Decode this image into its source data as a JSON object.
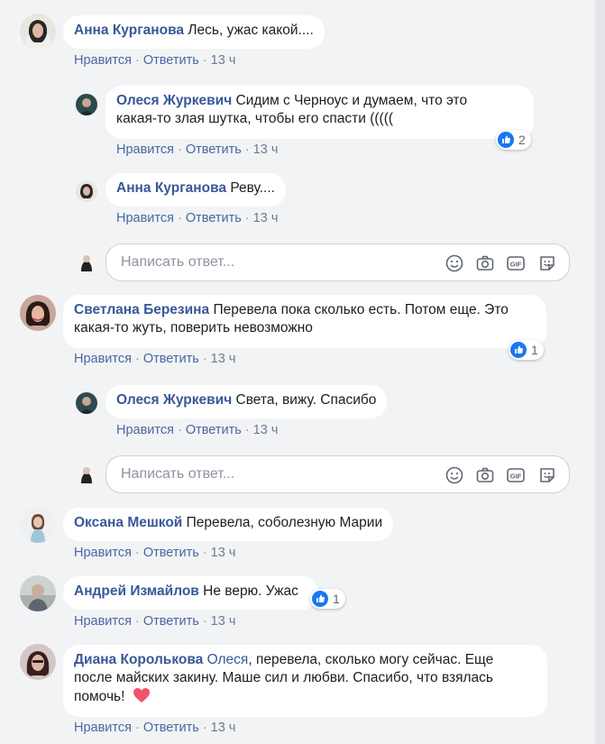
{
  "actions": {
    "like": "Нравится",
    "reply": "Ответить",
    "time": "13 ч",
    "separator": "·"
  },
  "reply_placeholder": "Написать ответ...",
  "comments": [
    {
      "author": "Анна Курганова",
      "text": "Лесь, ужас какой...."
    },
    {
      "author": "Олеся Журкевич",
      "text_line1": "Сидим с Черноус и думаем, что это",
      "text_line2": "какая-то злая шутка, чтобы его спасти (((((",
      "likes": "2"
    },
    {
      "author": "Анна Курганова",
      "text": "Реву...."
    },
    {
      "author": "Светлана Березина",
      "text_line1": "Перевела пока сколько есть. Потом еще. Это",
      "text_line2": "какая-то жуть, поверить невозможно",
      "likes": "1"
    },
    {
      "author": "Олеся Журкевич",
      "text": "Света, вижу. Спасибо"
    },
    {
      "author": "Оксана Мешкой",
      "text": "Перевела, соболезную Марии"
    },
    {
      "author": "Андрей Измайлов",
      "text": "Не верю. Ужас",
      "likes": "1"
    },
    {
      "author": "Диана Королькова",
      "mention": "Олеся",
      "text_line1": ", перевела, сколько могу сейчас. Еще",
      "text_line2": "после майских закину. Маше сил и любви. Спасибо, что взялась",
      "text_line3": "помочь!"
    }
  ],
  "colors": {
    "author": "#385898",
    "like_blue": "#1877f2",
    "heart": "#f0536b",
    "background": "#f2f3f5"
  }
}
